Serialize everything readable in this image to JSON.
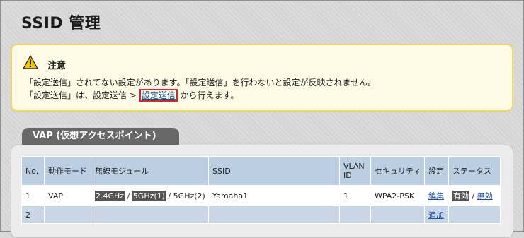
{
  "page": {
    "title": "SSID 管理"
  },
  "notice": {
    "title": "注意",
    "line1": "「設定送信」されてない設定があります。「設定送信」を行わないと設定が反映されません。",
    "line2_prefix": "「設定送信」は、設定送信 > ",
    "line2_link": "設定送信",
    "line2_suffix": " から行えます。"
  },
  "vap_section": {
    "tab_label": "VAP (仮想アクセスポイント)",
    "columns": {
      "no": "No.",
      "mode": "動作モード",
      "radio": "無線モジュール",
      "ssid": "SSID",
      "vlan_a": "VLAN",
      "vlan_b": "ID",
      "security": "セキュリティ",
      "settings": "設定",
      "status": "ステータス"
    },
    "rows": [
      {
        "no": "1",
        "mode": "VAP",
        "radio_24": "2.4GHz",
        "radio_5_1": "5GHz(1)",
        "radio_5_2": "5GHz(2)",
        "ssid": "Yamaha1",
        "vlan_id": "1",
        "security": "WPA2-PSK",
        "settings_link": "編集",
        "status_enabled": "有効",
        "status_disabled": "無効"
      },
      {
        "no": "2",
        "settings_link": "追加"
      }
    ],
    "separator": "/"
  },
  "colors": {
    "notice_border": "#f2d466",
    "notice_bg": "#fdfbe6",
    "link_highlight_border": "#d8242a",
    "table_header_bg": "#bccfe2",
    "tab_bg": "#686868",
    "link": "#1a4fa0"
  },
  "icons": {
    "warning": "warning-triangle-icon"
  }
}
